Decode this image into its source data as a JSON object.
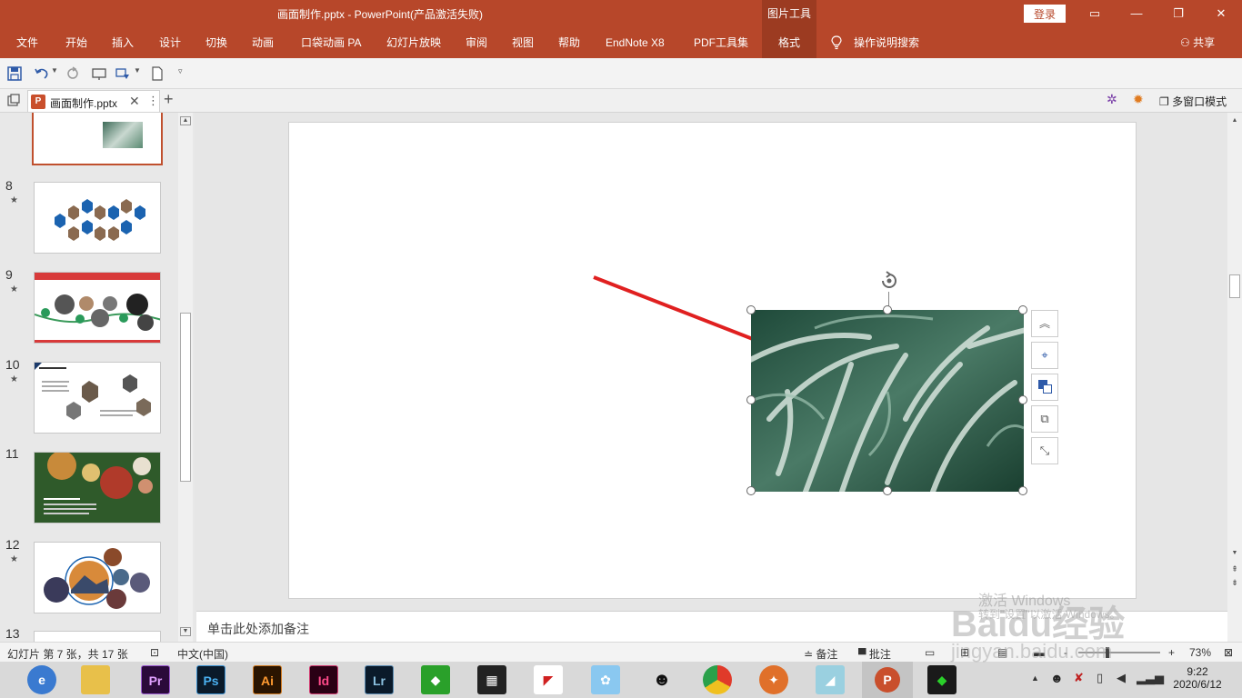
{
  "window": {
    "title": "画面制作.pptx  -  PowerPoint(产品激活失败)",
    "context_tool": "图片工具",
    "login_label": "登录"
  },
  "ribbon": {
    "tabs": [
      "文件",
      "开始",
      "插入",
      "设计",
      "切换",
      "动画",
      "口袋动画 PA",
      "幻灯片放映",
      "审阅",
      "视图",
      "帮助",
      "EndNote X8",
      "PDF工具集",
      "格式"
    ],
    "active_tab": "格式",
    "tell_me": "操作说明搜索",
    "share": "共享"
  },
  "doc_tab": {
    "name": "画面制作.pptx",
    "multi_window": "多窗口模式"
  },
  "slides": [
    {
      "number": "8",
      "star": "★"
    },
    {
      "number": "9",
      "star": "★"
    },
    {
      "number": "10",
      "star": "★"
    },
    {
      "number": "11",
      "star": ""
    },
    {
      "number": "12",
      "star": "★"
    },
    {
      "number": "13",
      "star": ""
    }
  ],
  "notes_placeholder": "单击此处添加备注",
  "status": {
    "slide_info": "幻灯片 第 7 张，共 17 张",
    "language": "中文(中国)",
    "notes": "备注",
    "comments": "批注",
    "zoom": "73%",
    "zoom_minus": "-",
    "zoom_plus": "+"
  },
  "taskbar": {
    "apps": [
      "browser",
      "file-explorer",
      "Pr",
      "Ps",
      "Ai",
      "Id",
      "Lr",
      "app-green",
      "film",
      "app-red",
      "app-bird",
      "qq",
      "chrome",
      "app-orange",
      "app-blue",
      "powerpoint",
      "app-green2"
    ],
    "time": "9:22",
    "date": "2020/6/12"
  },
  "watermark": {
    "baidu": "Baidu经验",
    "url": "jingyan.baidu.com",
    "activate": "激活 Windows",
    "activate_hint": "转到\"设置\"以激活 Windows。"
  },
  "colors": {
    "accent": "#b7472a",
    "accent_dark": "#9c3b21",
    "arrow": "#e02020"
  }
}
